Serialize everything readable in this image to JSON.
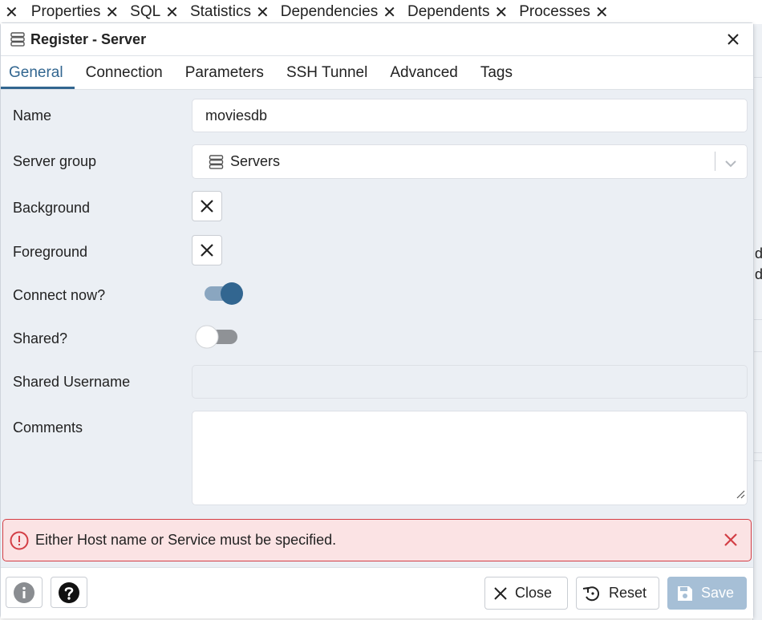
{
  "background_tabs": [
    {
      "label": "Properties"
    },
    {
      "label": "SQL"
    },
    {
      "label": "Statistics"
    },
    {
      "label": "Dependencies"
    },
    {
      "label": "Dependents"
    },
    {
      "label": "Processes"
    }
  ],
  "background_glyphs": [
    "d",
    "d"
  ],
  "dialog": {
    "title": "Register - Server",
    "tabs": [
      {
        "label": "General",
        "active": true
      },
      {
        "label": "Connection",
        "active": false
      },
      {
        "label": "Parameters",
        "active": false
      },
      {
        "label": "SSH Tunnel",
        "active": false
      },
      {
        "label": "Advanced",
        "active": false
      },
      {
        "label": "Tags",
        "active": false
      }
    ],
    "form": {
      "name": {
        "label": "Name",
        "value": "moviesdb"
      },
      "server_group": {
        "label": "Server group",
        "value": "Servers"
      },
      "background": {
        "label": "Background"
      },
      "foreground": {
        "label": "Foreground"
      },
      "connect_now": {
        "label": "Connect now?",
        "checked": true
      },
      "shared": {
        "label": "Shared?",
        "checked": false
      },
      "shared_username": {
        "label": "Shared Username",
        "value": ""
      },
      "comments": {
        "label": "Comments",
        "value": ""
      }
    },
    "alert": {
      "message": "Either Host name or Service must be specified.",
      "color": "#d33e45"
    },
    "footer": {
      "info_icon": "info-icon",
      "help_icon": "help-icon",
      "close_label": "Close",
      "reset_label": "Reset",
      "save_label": "Save"
    }
  },
  "colors": {
    "accent": "#326690",
    "dialog_bg": "#ebeff4",
    "save_disabled": "#a6bfd6",
    "error": "#d33e45"
  }
}
